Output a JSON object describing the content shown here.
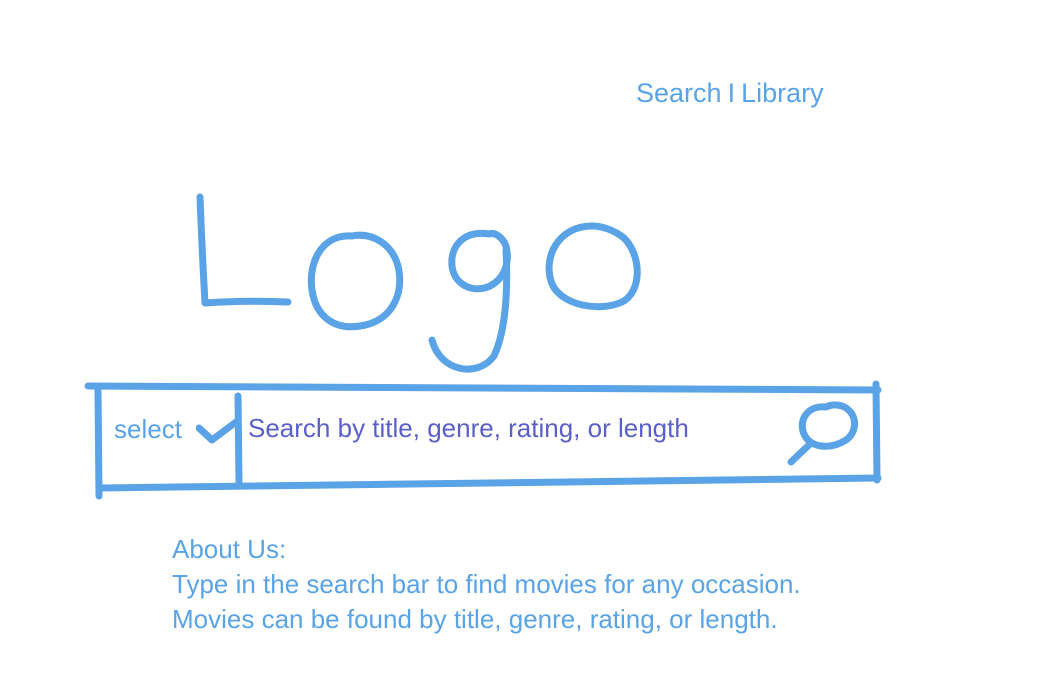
{
  "nav": {
    "search_label": "Search",
    "separator": "I",
    "library_label": "Library"
  },
  "logo": {
    "text": "Logo"
  },
  "search_bar": {
    "select_label": "select",
    "placeholder": "Search by title, genre, rating, or length",
    "search_icon": "magnifier-icon",
    "dropdown_icon": "chevron-down-icon"
  },
  "about": {
    "heading": "About Us:",
    "line1": "Type in the search bar to find movies for any occasion.",
    "line2": "Movies can be found by title, genre, rating, or length."
  },
  "colors": {
    "sketch_blue": "#5aa3e6",
    "placeholder_purple": "#5a5fc9",
    "background": "#ffffff"
  }
}
